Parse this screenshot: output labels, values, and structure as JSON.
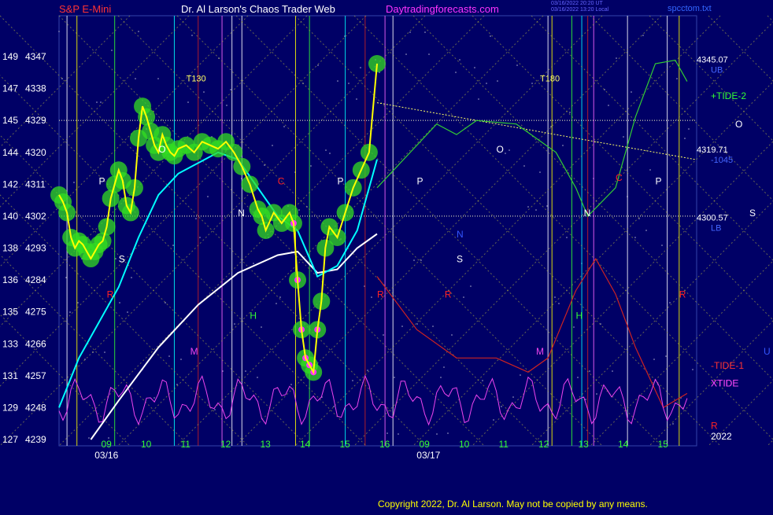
{
  "header": {
    "symbol": "S&P E-Mini",
    "author": "Dr. Al Larson's Chaos Trader Web",
    "site": "Daytradingforecasts.com",
    "stamp_line1": "03/16/2022 20:20 UT",
    "stamp_line2": "03/16/2022 13:20 Local",
    "file": "spcctom.txt"
  },
  "footer": {
    "copyright": "Copyright 2022, Dr. Al Larson. May not be copied by any means."
  },
  "colors": {
    "background": "#000066",
    "price": "#ffff00",
    "ma_fast": "#00ffff",
    "ma_slow": "#ffffff",
    "tide_plus": "#33cc33",
    "tide_minus": "#cc2222",
    "xtide": "#ee44ee",
    "glow": "#33dd22",
    "box": "#ffff66"
  },
  "chart_data": {
    "type": "line",
    "title": "S&P E-Mini",
    "y_axis": {
      "range": [
        4239,
        4347
      ],
      "ticks": [
        {
          "left": "149",
          "right": "4347"
        },
        {
          "left": "147",
          "right": "4338"
        },
        {
          "left": "145",
          "right": "4329"
        },
        {
          "left": "144",
          "right": "4320"
        },
        {
          "left": "142",
          "right": "4311"
        },
        {
          "left": "140",
          "right": "4302"
        },
        {
          "left": "138",
          "right": "4293"
        },
        {
          "left": "136",
          "right": "4284"
        },
        {
          "left": "135",
          "right": "4275"
        },
        {
          "left": "133",
          "right": "4266"
        },
        {
          "left": "131",
          "right": "4257"
        },
        {
          "left": "129",
          "right": "4248"
        },
        {
          "left": "127",
          "right": "4239"
        }
      ]
    },
    "x_axis": {
      "range": [
        8,
        39.5
      ],
      "hour_ticks": [
        {
          "t": 9,
          "label": "09"
        },
        {
          "t": 10,
          "label": "10"
        },
        {
          "t": 11,
          "label": "11"
        },
        {
          "t": 12,
          "label": "12"
        },
        {
          "t": 13,
          "label": "13"
        },
        {
          "t": 14,
          "label": "14"
        },
        {
          "t": 15,
          "label": "15"
        },
        {
          "t": 16,
          "label": "16"
        },
        {
          "t": 33,
          "label": "09"
        },
        {
          "t": 34,
          "label": "10"
        },
        {
          "t": 35,
          "label": "11"
        },
        {
          "t": 36,
          "label": "12"
        },
        {
          "t": 37,
          "label": "13"
        },
        {
          "t": 38,
          "label": "14"
        },
        {
          "t": 39,
          "label": "15"
        }
      ],
      "date_labels": [
        {
          "t": 8.5,
          "label": "03/16"
        },
        {
          "t": 16.6,
          "label": "03/17"
        }
      ]
    },
    "price_series": {
      "name": "S&P E-Mini",
      "points": [
        [
          8.0,
          4308
        ],
        [
          8.1,
          4306
        ],
        [
          8.2,
          4303
        ],
        [
          8.3,
          4296
        ],
        [
          8.4,
          4293
        ],
        [
          8.5,
          4295
        ],
        [
          8.6,
          4294
        ],
        [
          8.7,
          4292
        ],
        [
          8.8,
          4290
        ],
        [
          8.9,
          4292
        ],
        [
          9.0,
          4294
        ],
        [
          9.1,
          4295
        ],
        [
          9.2,
          4299
        ],
        [
          9.3,
          4307
        ],
        [
          9.4,
          4311
        ],
        [
          9.5,
          4315
        ],
        [
          9.6,
          4312
        ],
        [
          9.7,
          4305
        ],
        [
          9.8,
          4303
        ],
        [
          9.9,
          4310
        ],
        [
          10.0,
          4324
        ],
        [
          10.1,
          4333
        ],
        [
          10.2,
          4330
        ],
        [
          10.3,
          4326
        ],
        [
          10.4,
          4322
        ],
        [
          10.5,
          4320
        ],
        [
          10.6,
          4325
        ],
        [
          10.7,
          4322
        ],
        [
          10.8,
          4320
        ],
        [
          10.9,
          4319
        ],
        [
          11.0,
          4321
        ],
        [
          11.2,
          4322
        ],
        [
          11.4,
          4320
        ],
        [
          11.6,
          4323
        ],
        [
          11.8,
          4322
        ],
        [
          12.0,
          4321
        ],
        [
          12.2,
          4323
        ],
        [
          12.4,
          4320
        ],
        [
          12.6,
          4316
        ],
        [
          12.8,
          4311
        ],
        [
          13.0,
          4304
        ],
        [
          13.1,
          4302
        ],
        [
          13.2,
          4298
        ],
        [
          13.4,
          4303
        ],
        [
          13.6,
          4300
        ],
        [
          13.8,
          4303
        ],
        [
          13.9,
          4300
        ],
        [
          14.0,
          4284
        ],
        [
          14.1,
          4270
        ],
        [
          14.2,
          4262
        ],
        [
          14.3,
          4260
        ],
        [
          14.4,
          4258
        ],
        [
          14.5,
          4270
        ],
        [
          14.6,
          4278
        ],
        [
          14.7,
          4293
        ],
        [
          14.8,
          4299
        ],
        [
          15.0,
          4296
        ],
        [
          15.2,
          4303
        ],
        [
          15.4,
          4310
        ],
        [
          15.6,
          4315
        ],
        [
          15.8,
          4320
        ],
        [
          16.0,
          4345
        ]
      ]
    },
    "ma_fast": {
      "points": [
        [
          8.0,
          4248
        ],
        [
          8.5,
          4262
        ],
        [
          9.0,
          4272
        ],
        [
          9.5,
          4282
        ],
        [
          10.0,
          4296
        ],
        [
          10.5,
          4308
        ],
        [
          11.0,
          4314
        ],
        [
          11.5,
          4317
        ],
        [
          12.0,
          4320
        ],
        [
          12.5,
          4318
        ],
        [
          13.0,
          4310
        ],
        [
          13.5,
          4302
        ],
        [
          14.0,
          4298
        ],
        [
          14.5,
          4285
        ],
        [
          15.0,
          4288
        ],
        [
          15.5,
          4298
        ],
        [
          16.0,
          4318
        ]
      ]
    },
    "ma_slow": {
      "points": [
        [
          8.8,
          4239
        ],
        [
          9.5,
          4250
        ],
        [
          10.5,
          4265
        ],
        [
          11.5,
          4277
        ],
        [
          12.5,
          4286
        ],
        [
          13.5,
          4291
        ],
        [
          14.0,
          4292
        ],
        [
          14.5,
          4286
        ],
        [
          15.0,
          4287
        ],
        [
          15.5,
          4293
        ],
        [
          16.0,
          4297
        ]
      ]
    },
    "projection": {
      "name": "+TIDE-2",
      "points": [
        [
          16.0,
          4310
        ],
        [
          16.5,
          4316
        ],
        [
          17.5,
          4328
        ],
        [
          18.0,
          4325
        ],
        [
          18.5,
          4329
        ],
        [
          19.5,
          4328
        ],
        [
          20.5,
          4320
        ],
        [
          21.0,
          4310
        ],
        [
          21.3,
          4302
        ],
        [
          22.0,
          4310
        ],
        [
          22.5,
          4330
        ],
        [
          23.0,
          4345
        ],
        [
          23.5,
          4346
        ],
        [
          23.8,
          4340
        ]
      ]
    },
    "tide_minus": {
      "name": "-TIDE-1",
      "points": [
        [
          16.0,
          4285
        ],
        [
          17.0,
          4270
        ],
        [
          18.0,
          4262
        ],
        [
          19.0,
          4262
        ],
        [
          19.8,
          4258
        ],
        [
          20.3,
          4262
        ],
        [
          21.0,
          4281
        ],
        [
          21.5,
          4290
        ],
        [
          22.0,
          4280
        ],
        [
          22.5,
          4265
        ],
        [
          23.2,
          4248
        ],
        [
          23.8,
          4252
        ]
      ]
    },
    "xtide_label": "XTIDE",
    "levels": [
      {
        "label": "4345.07",
        "sub": "UB",
        "value": 4345.07,
        "color": "#4466ff"
      },
      {
        "label": "4319.71",
        "sub": "-1045",
        "value": 4319.71,
        "color": "#4466ff"
      },
      {
        "label": "4300.57",
        "sub": "LB",
        "value": 4300.57,
        "color": "#4466ff"
      }
    ],
    "hline_values": [
      4329,
      4302
    ],
    "trend_line": [
      [
        16.0,
        4334
      ],
      [
        24.0,
        4318
      ]
    ],
    "time_labels": [
      {
        "t": 11.2,
        "v": 4340,
        "text": "T130",
        "color": "#ffff66"
      },
      {
        "t": 20.1,
        "v": 4340,
        "text": "T180",
        "color": "#ffff66"
      }
    ],
    "planet_markers": [
      {
        "t": 9.0,
        "v": 4311,
        "text": "P",
        "color": "#ffffff"
      },
      {
        "t": 10.5,
        "v": 4320,
        "text": "O",
        "color": "#ffffff"
      },
      {
        "t": 12.5,
        "v": 4302,
        "text": "N",
        "color": "#ffffff"
      },
      {
        "t": 15.0,
        "v": 4311,
        "text": "P",
        "color": "#ffffff"
      },
      {
        "t": 9.5,
        "v": 4289,
        "text": "S",
        "color": "#ffffff"
      },
      {
        "t": 13.5,
        "v": 4311,
        "text": "C",
        "color": "#ff2222"
      },
      {
        "t": 9.2,
        "v": 4279,
        "text": "R",
        "color": "#ff2222"
      },
      {
        "t": 12.8,
        "v": 4273,
        "text": "H",
        "color": "#33ff33"
      },
      {
        "t": 11.3,
        "v": 4263,
        "text": "M",
        "color": "#ee44ee"
      },
      {
        "t": 17.0,
        "v": 4311,
        "text": "P",
        "color": "#ffffff"
      },
      {
        "t": 19.0,
        "v": 4320,
        "text": "O",
        "color": "#ffffff"
      },
      {
        "t": 21.2,
        "v": 4302,
        "text": "N",
        "color": "#ffffff"
      },
      {
        "t": 23.0,
        "v": 4311,
        "text": "P",
        "color": "#ffffff"
      },
      {
        "t": 18.0,
        "v": 4289,
        "text": "S",
        "color": "#ffffff"
      },
      {
        "t": 18.0,
        "v": 4296,
        "text": "N",
        "color": "#3355ff"
      },
      {
        "t": 16.0,
        "v": 4279,
        "text": "R",
        "color": "#ff2222"
      },
      {
        "t": 17.7,
        "v": 4279,
        "text": "R",
        "color": "#ff2222"
      },
      {
        "t": 22.0,
        "v": 4312,
        "text": "C",
        "color": "#ff2222"
      },
      {
        "t": 23.6,
        "v": 4279,
        "text": "R",
        "color": "#ff2222"
      },
      {
        "t": 21.0,
        "v": 4273,
        "text": "H",
        "color": "#33ff33"
      },
      {
        "t": 20.0,
        "v": 4263,
        "text": "M",
        "color": "#ee44ee"
      }
    ],
    "side_labels": [
      {
        "text": "+TIDE-2",
        "v": 4335,
        "color": "#33ff33"
      },
      {
        "text": "O",
        "v": 4327,
        "color": "#ffffff"
      },
      {
        "text": "S",
        "v": 4302,
        "color": "#ffffff"
      },
      {
        "text": "-TIDE-1",
        "v": 4259,
        "color": "#ff3333"
      },
      {
        "text": "XTIDE",
        "v": 4254,
        "color": "#ee44ee"
      },
      {
        "text": "U",
        "v": 4263,
        "color": "#3355ff"
      },
      {
        "text": "R",
        "v": 4242,
        "color": "#ff2222"
      },
      {
        "text": "2022",
        "v": 4239,
        "color": "#ffffff"
      }
    ]
  }
}
